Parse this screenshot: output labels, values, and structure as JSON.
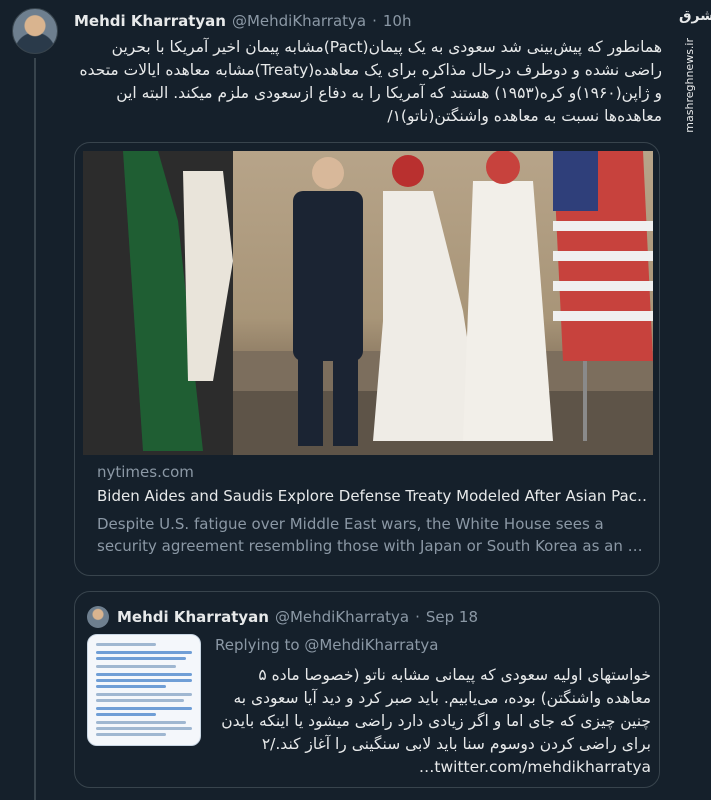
{
  "tweet": {
    "author_name": "Mehdi Kharratyan",
    "handle": "@MehdiKharratya",
    "separator": "·",
    "time": "10h",
    "text": "همانطور که پیش‌بینی شد سعودی به یک پیمان(Pact)مشابه پیمان اخیر آمریکا با بحرین راضی نشده و دوطرف درحال مذاکره برای یک معاهده(Treaty)مشابه معاهده ایالات متحده و ژاپن(۱۹۶۰)و کره(۱۹۵۳) هستند که آمریکا را به دفاع ازسعودی ملزم میکند. البته این معاهده‌ها نسبت به معاهده واشنگتن(ناتو)۱/"
  },
  "watermark": {
    "logo": "مشرق",
    "site": "mashreghnews.ir"
  },
  "link_card": {
    "domain": "nytimes.com",
    "title": "Biden Aides and Saudis Explore Defense Treaty Modeled After Asian Pac…",
    "description": "Despite U.S. fatigue over Middle East wars, the White House sees a security agreement resembling those with Japan or South Korea as an …"
  },
  "quoted_tweet": {
    "author_name": "Mehdi Kharratyan",
    "handle": "@MehdiKharratya",
    "separator": "·",
    "date": "Sep 18",
    "replying_prefix": "Replying to",
    "replying_handle": "@MehdiKharratya",
    "text": "خواستهای اولیه سعودی که پیمانی مشابه ناتو (خصوصا ماده ۵ معاهده واشنگتن) بوده، می‌یابیم. باید صبر کرد و دید آیا سعودی به چنین چیزی که جای اما و اگر زیادی دارد راضی میشود یا اینکه بایدن برای راضی کردن دوسوم سنا باید لابی سنگینی را آغاز کند./۲ twitter.com/mehdikharratya…"
  }
}
